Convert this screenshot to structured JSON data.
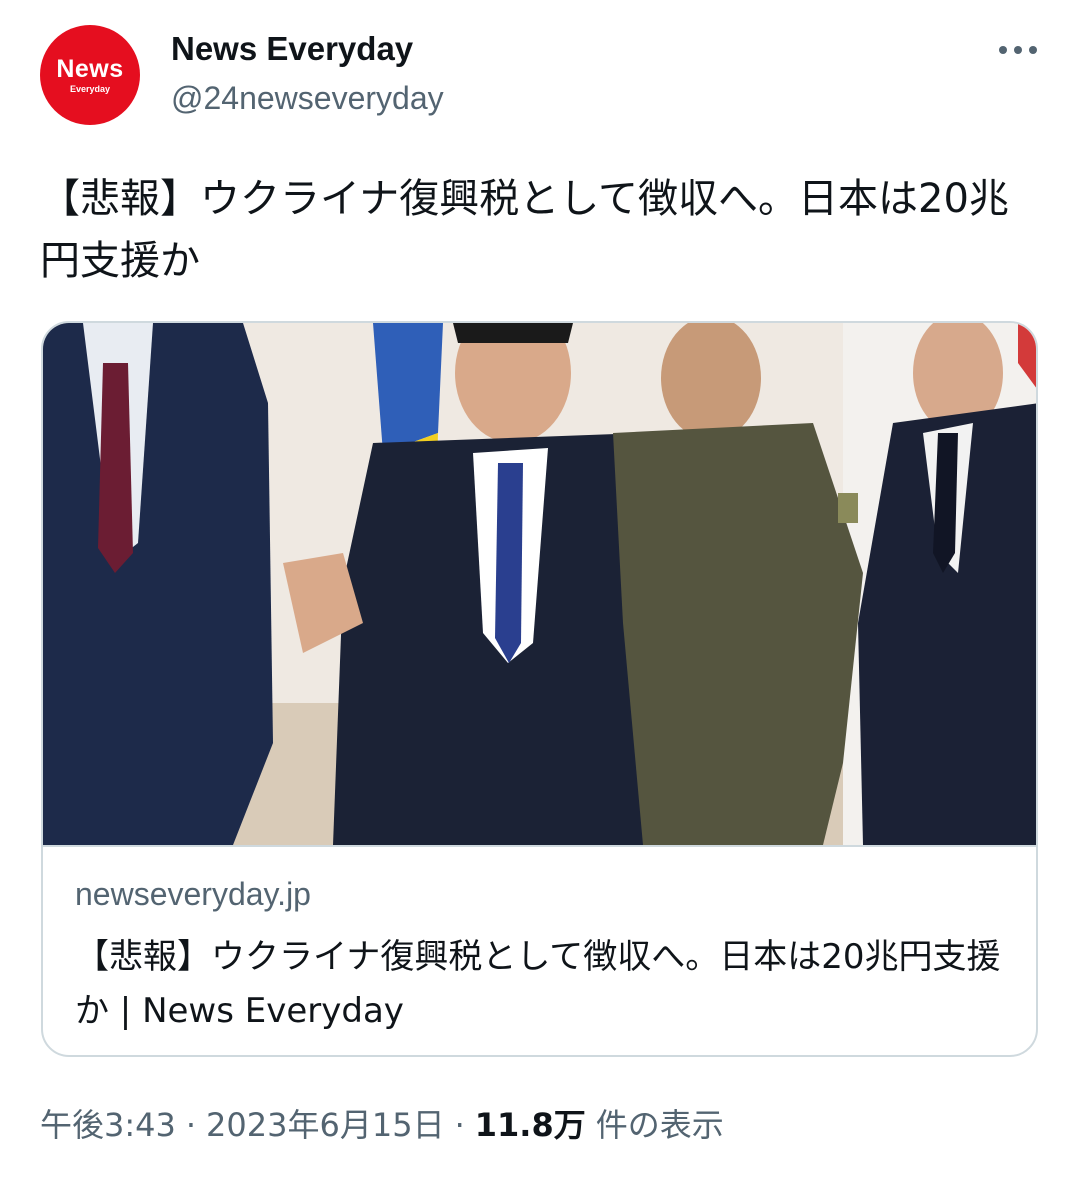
{
  "account": {
    "avatar_text_main": "News",
    "avatar_text_sub": "Everyday",
    "display_name": "News Everyday",
    "handle": "@24newseveryday"
  },
  "menu": {
    "icon": "more-horizontal-icon"
  },
  "tweet": {
    "text": "【悲報】ウクライナ復興税として徴収へ。日本は20兆円支援か"
  },
  "card": {
    "image_alt": "photo-of-four-men-in-suits-and-military-shirt-with-ukrainian-flag",
    "domain": "newseveryday.jp",
    "title": "【悲報】ウクライナ復興税として徴収へ。日本は20兆円支援か | News Everyday"
  },
  "meta": {
    "time": "午後3:43",
    "separator": "·",
    "date": "2023年6月15日",
    "views_count": "11.8万",
    "views_label": "件の表示"
  },
  "colors": {
    "avatar_bg": "#e50e1f",
    "text_primary": "#0f1419",
    "text_secondary": "#536471",
    "border": "#cfd9de"
  }
}
